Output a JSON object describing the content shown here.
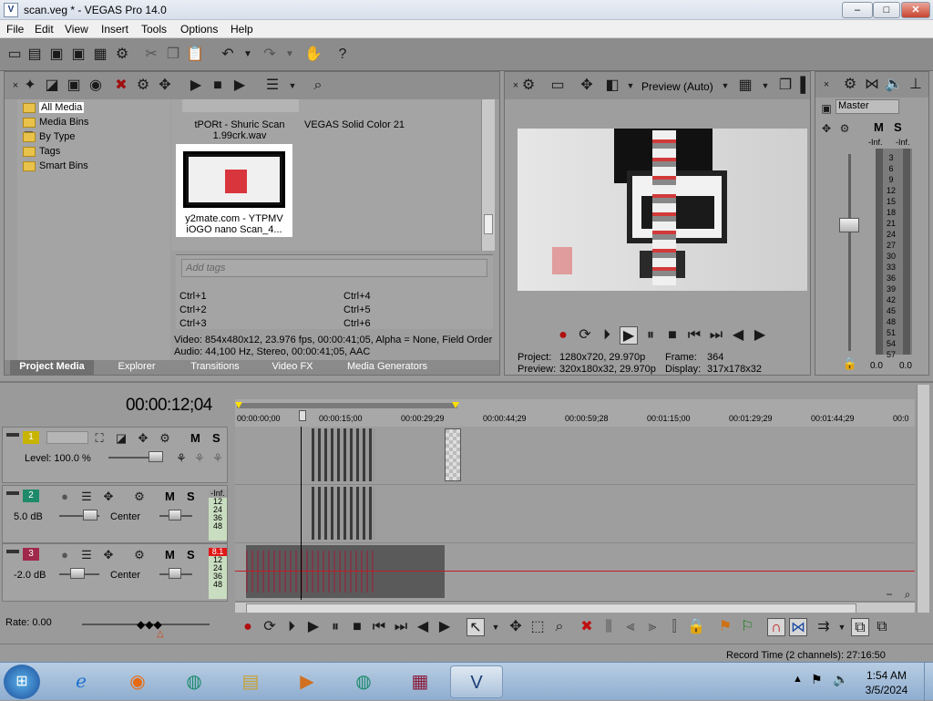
{
  "window": {
    "title": "scan.veg * - VEGAS Pro 14.0",
    "logo": "V",
    "minimize": "–",
    "maximize": "□",
    "close": "✕"
  },
  "menu": [
    "File",
    "Edit",
    "View",
    "Insert",
    "Tools",
    "Options",
    "Help"
  ],
  "project_media": {
    "tree": [
      "All Media",
      "Media Bins",
      "By Type",
      "Tags",
      "Smart Bins"
    ],
    "media_items": [
      {
        "name": "tPORt - Shuric Scan 1.99crk.wav"
      },
      {
        "name": "VEGAS Solid Color 21"
      },
      {
        "name": "y2mate.com - YTPMV iOGO nano Scan_4..."
      }
    ],
    "thumb_caption_line1": "y2mate.com - YTPMV",
    "thumb_caption_line2": "iOGO nano Scan_4...",
    "wav_line1": "tPORt - Shuric Scan",
    "wav_line2": "1.99crk.wav",
    "solid_color": "VEGAS Solid Color 21",
    "add_tags_placeholder": "Add tags",
    "shortcuts": [
      "Ctrl+1",
      "Ctrl+2",
      "Ctrl+3",
      "Ctrl+4",
      "Ctrl+5",
      "Ctrl+6"
    ],
    "video_info": "Video: 854x480x12, 23.976 fps, 00:00:41;05, Alpha = None, Field Order",
    "audio_info": "Audio: 44,100 Hz, Stereo, 00:00:41;05, AAC",
    "tabs": [
      "Project Media",
      "Explorer",
      "Transitions",
      "Video FX",
      "Media Generators"
    ]
  },
  "preview": {
    "mode": "Preview (Auto)",
    "project_label": "Project:",
    "project_value": "1280x720, 29.970p",
    "preview_label": "Preview:",
    "preview_value": "320x180x32, 29.970p",
    "frame_label": "Frame:",
    "frame_value": "364",
    "display_label": "Display:",
    "display_value": "317x178x32"
  },
  "master": {
    "label": "Master",
    "m": "M",
    "s": "S",
    "inf_left": "-Inf.",
    "inf_right": "-Inf.",
    "scale": [
      "3",
      "6",
      "9",
      "12",
      "15",
      "18",
      "21",
      "24",
      "27",
      "30",
      "33",
      "36",
      "39",
      "42",
      "45",
      "48",
      "51",
      "54",
      "57"
    ],
    "value_left": "0.0",
    "value_right": "0.0"
  },
  "timeline": {
    "time": "00:00:12;04",
    "ruler": [
      "00:00:00;00",
      "00:00:15;00",
      "00:00:29;29",
      "00:00:44;29",
      "00:00:59;28",
      "00:01:15;00",
      "00:01:29;29",
      "00:01:44;29",
      "00:0"
    ],
    "tracks": [
      {
        "num": "1",
        "level": "Level: 100.0 %",
        "m": "M",
        "s": "S",
        "color": "#c8b400"
      },
      {
        "num": "2",
        "level": "5.0 dB",
        "pan": "Center",
        "m": "M",
        "s": "S",
        "color": "#1e8a6a",
        "meter": [
          "-Inf.",
          "12",
          "24",
          "36",
          "48"
        ]
      },
      {
        "num": "3",
        "level": "-2.0 dB",
        "pan": "Center",
        "m": "M",
        "s": "S",
        "color": "#a0284a",
        "meter": [
          "8.1",
          "12",
          "24",
          "36",
          "48"
        ]
      }
    ]
  },
  "transport": {
    "rate": "Rate: 0.00"
  },
  "status": {
    "record_time": "Record Time (2 channels): 27:16:50"
  },
  "taskbar": {
    "time": "1:54 AM",
    "date": "3/5/2024"
  }
}
